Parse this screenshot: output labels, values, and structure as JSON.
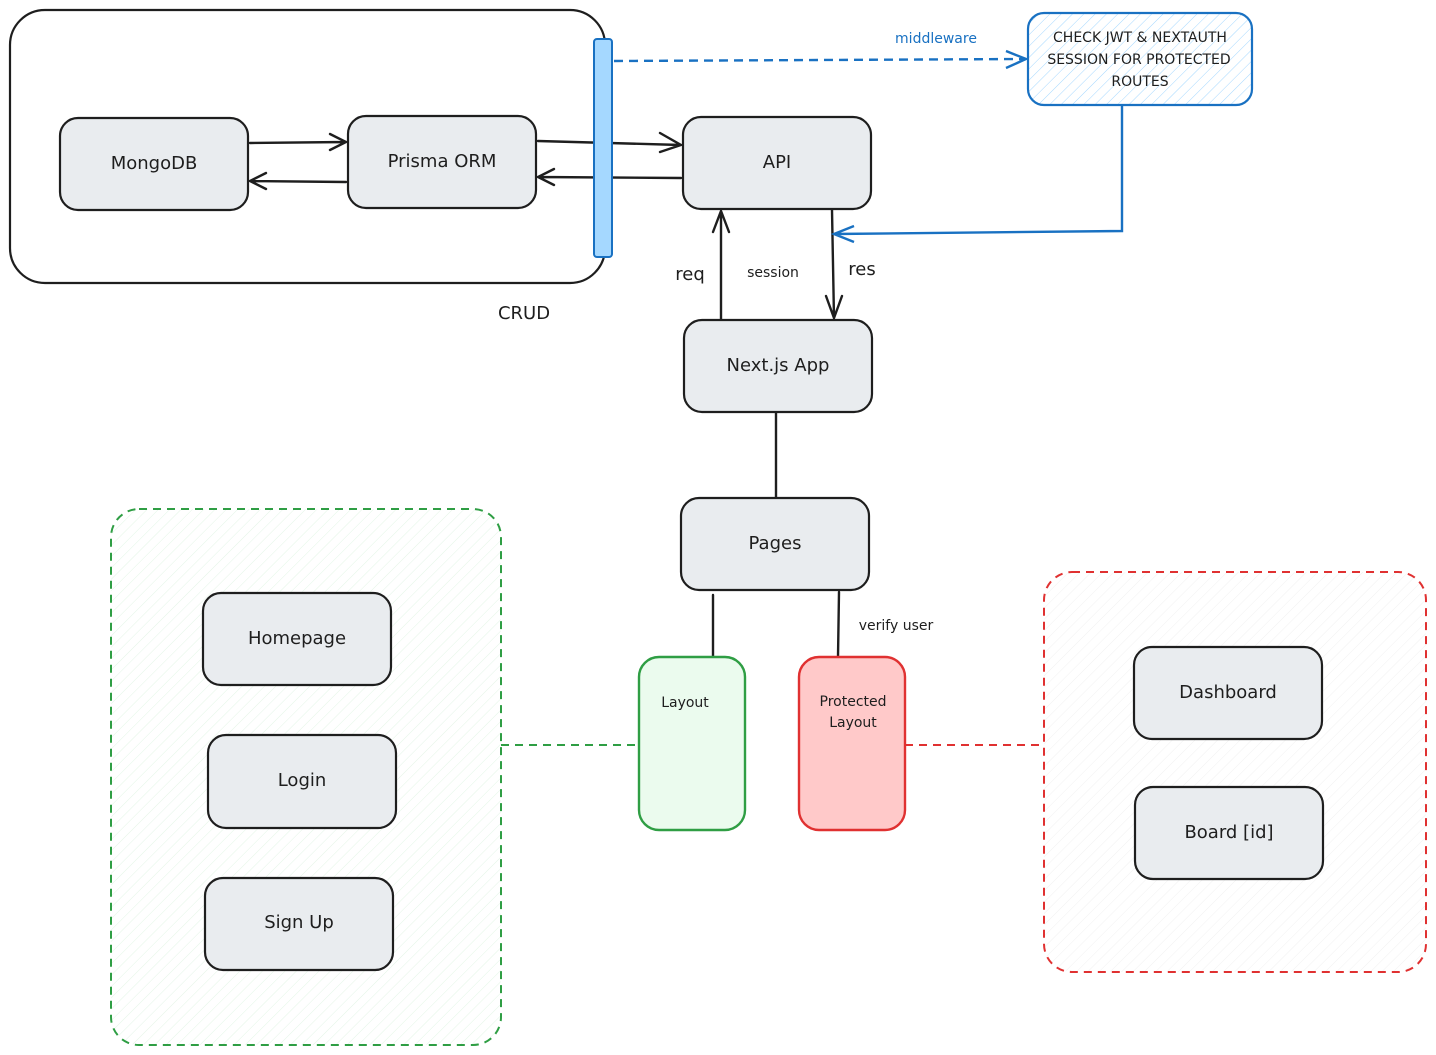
{
  "colors": {
    "stroke": "#1e1e1e",
    "node_fill": "#e9ecef",
    "blue": "#1971c2",
    "blue_fill": "#a5d8ff",
    "green": "#2f9e44",
    "green_fill": "#ebfbee",
    "red": "#e03131",
    "red_fill": "#ffc9c9"
  },
  "nodes": {
    "mongodb": "MongoDB",
    "prisma": "Prisma ORM",
    "api": "API",
    "nextjs": "Next.js App",
    "pages": "Pages",
    "homepage": "Homepage",
    "login": "Login",
    "signup": "Sign Up",
    "dashboard": "Dashboard",
    "board": "Board [id]",
    "layout": "Layout",
    "protected_line1": "Protected",
    "protected_line2": "Layout",
    "middleware_line1": "CHECK JWT & NEXTAUTH",
    "middleware_line2": "SESSION FOR PROTECTED",
    "middleware_line3": "ROUTES"
  },
  "labels": {
    "crud": "CRUD",
    "middleware": "middleware",
    "req": "req",
    "session": "session",
    "res": "res",
    "verify_user": "verify user"
  }
}
